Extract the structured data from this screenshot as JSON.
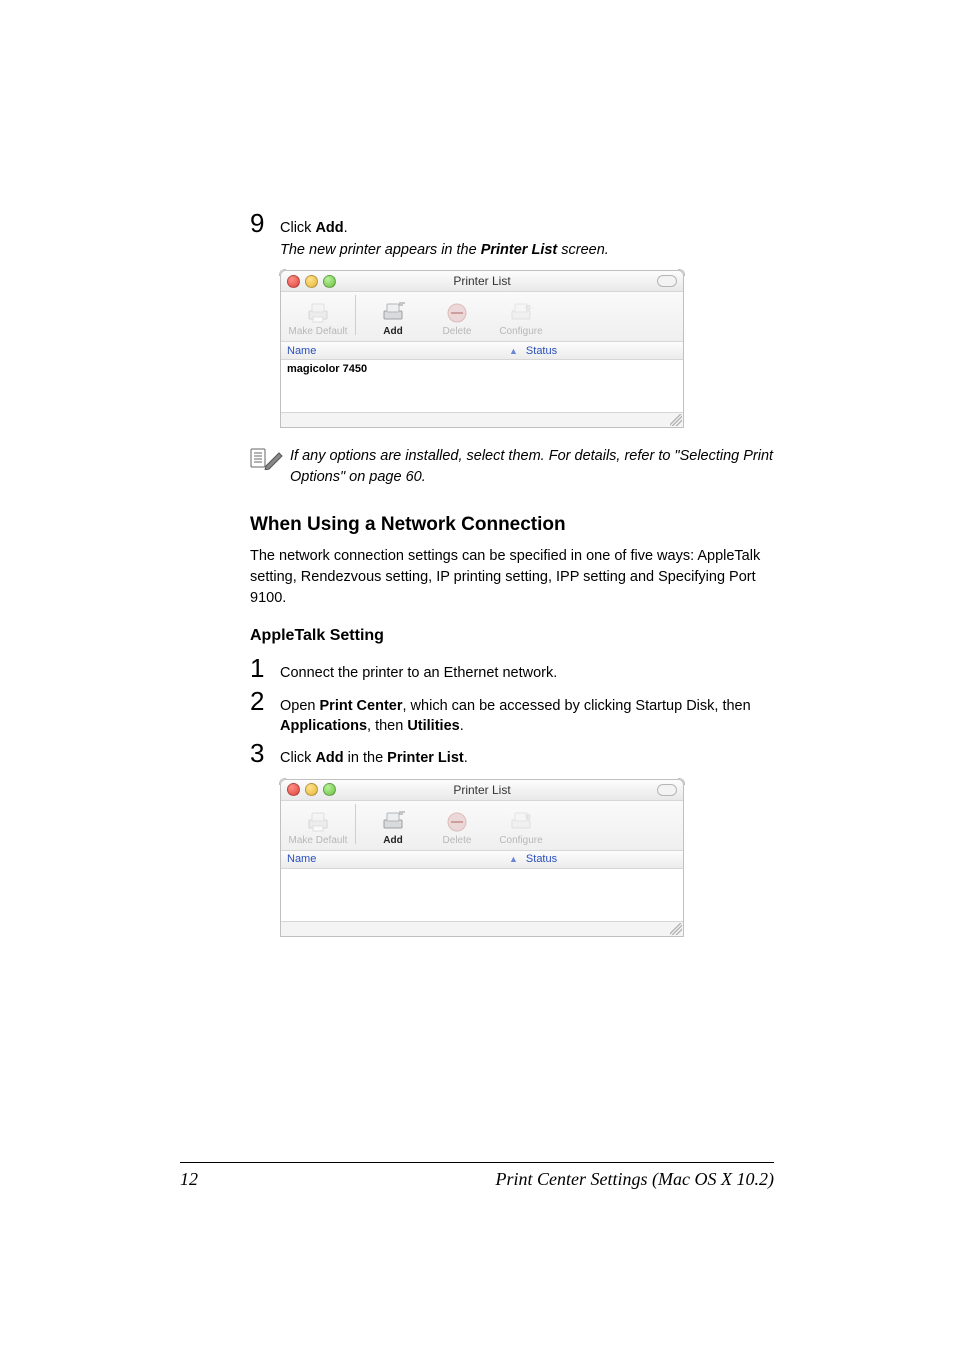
{
  "step9": {
    "num": "9",
    "pre": "Click ",
    "bold": "Add",
    "post": "."
  },
  "step9_italic_pre": "The new printer appears in the ",
  "step9_italic_bold": "Printer List",
  "step9_italic_post": " screen.",
  "win": {
    "title": "Printer List",
    "tb": {
      "makeDefault": "Make Default",
      "add": "Add",
      "delete": "Delete",
      "configure": "Configure"
    },
    "cols": {
      "name": "Name",
      "status": "Status"
    }
  },
  "printer_row": "magicolor 7450",
  "note": "If any options are installed, select them. For details, refer to \"Selecting Print Options\" on page 60.",
  "h2": "When Using a Network Connection",
  "para": "The network connection settings can be specified in one of five ways: AppleTalk setting, Rendezvous setting, IP printing setting, IPP setting and Specifying Port 9100.",
  "h3": "AppleTalk Setting",
  "step1": {
    "num": "1",
    "text": "Connect the printer to an Ethernet network."
  },
  "step2": {
    "num": "2",
    "pre": "Open ",
    "b1": "Print Center",
    "mid": ", which can be accessed by clicking Startup Disk, then ",
    "b2": "Applications",
    "mid2": ", then ",
    "b3": "Utilities",
    "post": "."
  },
  "step3": {
    "num": "3",
    "pre": "Click ",
    "b1": "Add",
    "mid": " in the ",
    "b2": "Printer List",
    "post": "."
  },
  "footer": {
    "page": "12",
    "title": "Print Center Settings (Mac OS X 10.2)"
  }
}
